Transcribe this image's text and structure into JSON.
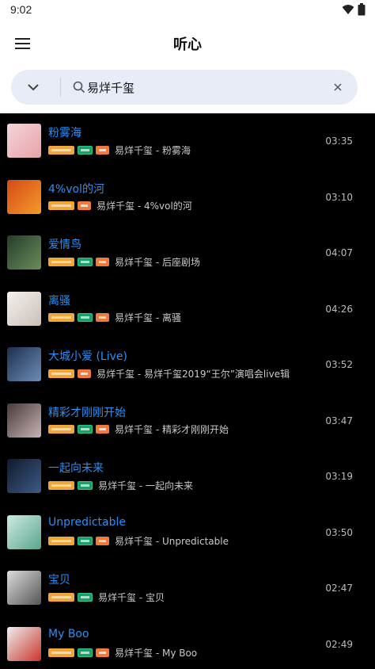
{
  "status": {
    "time": "9:02"
  },
  "app": {
    "title": "听心"
  },
  "search": {
    "query": "易烊千玺"
  },
  "songs": [
    {
      "title": "粉雾海",
      "subtitle": "易烊千玺 - 粉雾海",
      "duration": "03:35",
      "badges": [
        "vip",
        "mv",
        "hot"
      ]
    },
    {
      "title": "4%vol的河",
      "subtitle": "易烊千玺 - 4%vol的河",
      "duration": "03:10",
      "badges": [
        "vip",
        "hot"
      ]
    },
    {
      "title": "爱情鸟",
      "subtitle": "易烊千玺 - 后座剧场",
      "duration": "04:07",
      "badges": [
        "vip",
        "mv",
        "hot"
      ]
    },
    {
      "title": "离骚",
      "subtitle": "易烊千玺 - 离骚",
      "duration": "04:26",
      "badges": [
        "vip",
        "mv",
        "hot"
      ]
    },
    {
      "title": "大城小爱 (Live)",
      "subtitle": "易烊千玺 - 易烊千玺2019“王尔”演唱会live辑",
      "duration": "03:52",
      "badges": [
        "vip",
        "hot"
      ]
    },
    {
      "title": "精彩才刚刚开始",
      "subtitle": "易烊千玺 - 精彩才刚刚开始",
      "duration": "03:47",
      "badges": [
        "vip",
        "mv",
        "hot"
      ]
    },
    {
      "title": "一起向未来",
      "subtitle": "易烊千玺 - 一起向未来",
      "duration": "03:19",
      "badges": [
        "vip",
        "mv"
      ]
    },
    {
      "title": "Unpredictable",
      "subtitle": "易烊千玺 - Unpredictable",
      "duration": "03:50",
      "badges": [
        "vip",
        "mv",
        "hot"
      ]
    },
    {
      "title": "宝贝",
      "subtitle": "易烊千玺 - 宝贝",
      "duration": "02:47",
      "badges": [
        "vip",
        "mv"
      ]
    },
    {
      "title": "My Boo",
      "subtitle": "易烊千玺 - My Boo",
      "duration": "02:49",
      "badges": [
        "vip",
        "mv",
        "hot"
      ]
    }
  ],
  "colors": {
    "accent": "#2a8ff7",
    "background": "#000000",
    "search_bg": "#e7ecf6"
  }
}
